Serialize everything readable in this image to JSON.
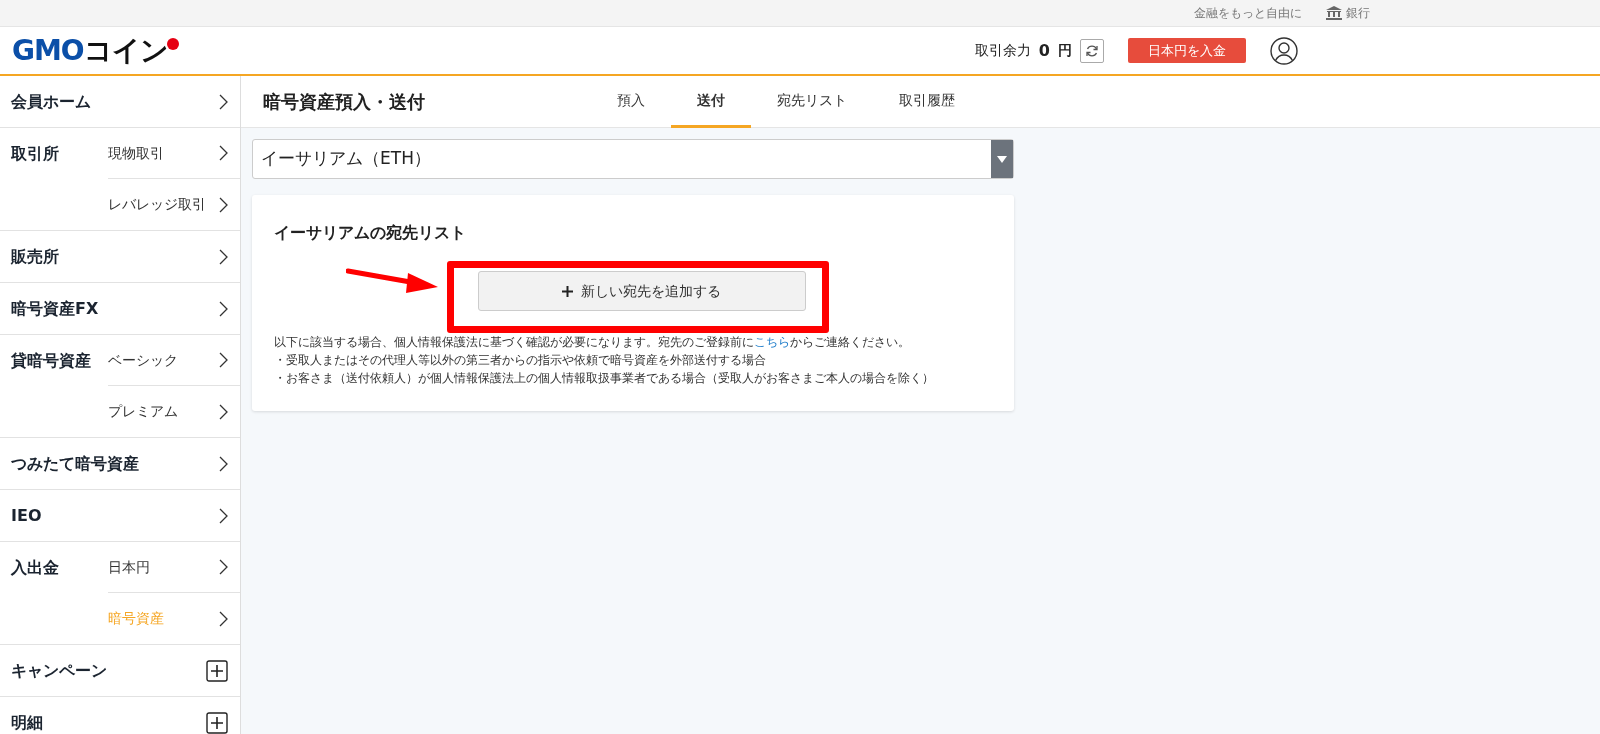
{
  "top_bar": {
    "tagline": "金融をもっと自由に",
    "bank_link": "銀行"
  },
  "header": {
    "logo": {
      "part_1": "GMO",
      "part_2": "コイン"
    },
    "balance_label": "取引余力",
    "balance_value": "0",
    "balance_unit": "円",
    "deposit_button": "日本円を入金"
  },
  "sidebar": {
    "items": [
      {
        "label": "会員ホーム",
        "kind": "link"
      },
      {
        "label": "取引所",
        "kind": "link",
        "children": [
          {
            "label": "現物取引",
            "selected": false
          },
          {
            "label": "レバレッジ取引",
            "selected": false
          }
        ]
      },
      {
        "label": "販売所",
        "kind": "link"
      },
      {
        "label": "暗号資産FX",
        "kind": "link"
      },
      {
        "label": "貸暗号資産",
        "kind": "link",
        "children": [
          {
            "label": "ベーシック",
            "selected": false
          },
          {
            "label": "プレミアム",
            "selected": false
          }
        ]
      },
      {
        "label": "つみたて暗号資産",
        "kind": "link"
      },
      {
        "label": "IEO",
        "kind": "link"
      },
      {
        "label": "入出金",
        "kind": "link",
        "children": [
          {
            "label": "日本円",
            "selected": false
          },
          {
            "label": "暗号資産",
            "selected": true
          }
        ]
      },
      {
        "label": "キャンペーン",
        "kind": "expand"
      },
      {
        "label": "明細",
        "kind": "expand"
      }
    ]
  },
  "page": {
    "title": "暗号資産預入・送付",
    "tabs": [
      {
        "label": "預入",
        "selected": false
      },
      {
        "label": "送付",
        "selected": true
      },
      {
        "label": "宛先リスト",
        "selected": false
      },
      {
        "label": "取引履歴",
        "selected": false
      }
    ]
  },
  "currency_select": {
    "value": "イーサリアム（ETH）"
  },
  "card": {
    "title": "イーサリアムの宛先リスト",
    "add_button": "新しい宛先を追加する",
    "notice": {
      "before": "以下に該当する場合、個人情報保護法に基づく確認が必要になります。宛先のご登録前に",
      "link": "こちら",
      "after": "からご連絡ください。"
    },
    "bullets": [
      "・受取人またはその代理人等以外の第三者からの指示や依頼で暗号資産を外部送付する場合",
      "・お客さま（送付依頼人）が個人情報保護法上の個人情報取扱事業者である場合（受取人がお客さまご本人の場合を除く）"
    ]
  }
}
